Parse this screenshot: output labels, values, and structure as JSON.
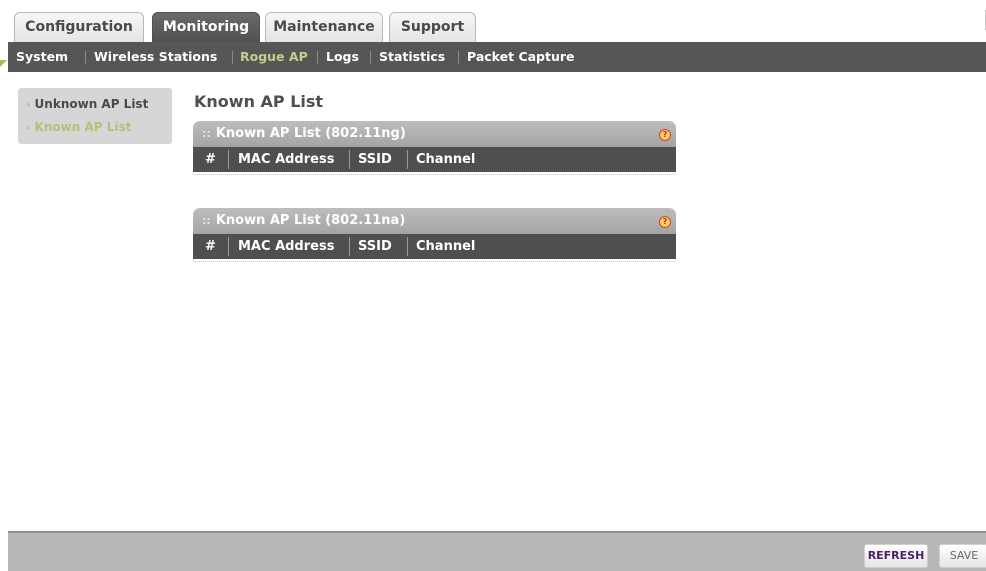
{
  "tabs": [
    {
      "label": "Configuration"
    },
    {
      "label": "Monitoring"
    },
    {
      "label": "Maintenance"
    },
    {
      "label": "Support"
    }
  ],
  "subnav": [
    {
      "label": "System"
    },
    {
      "label": "Wireless Stations"
    },
    {
      "label": "Rogue AP"
    },
    {
      "label": "Logs"
    },
    {
      "label": "Statistics"
    },
    {
      "label": "Packet Capture"
    }
  ],
  "sidemenu": [
    {
      "label": "Unknown AP List"
    },
    {
      "label": "Known AP List"
    }
  ],
  "page_title": "Known AP List",
  "panels": [
    {
      "title": "Known AP List (802.11ng)",
      "columns": [
        "#",
        "MAC Address",
        "SSID",
        "Channel"
      ]
    },
    {
      "title": "Known AP List (802.11na)",
      "columns": [
        "#",
        "MAC Address",
        "SSID",
        "Channel"
      ]
    }
  ],
  "help_icon_glyph": "?",
  "buttons": {
    "refresh": "REFRESH",
    "save": "SAVE"
  },
  "colors": {
    "active_tab": "#565656",
    "active_subnav": "#c6cc8d",
    "panel_header": "#4f4f4f"
  }
}
